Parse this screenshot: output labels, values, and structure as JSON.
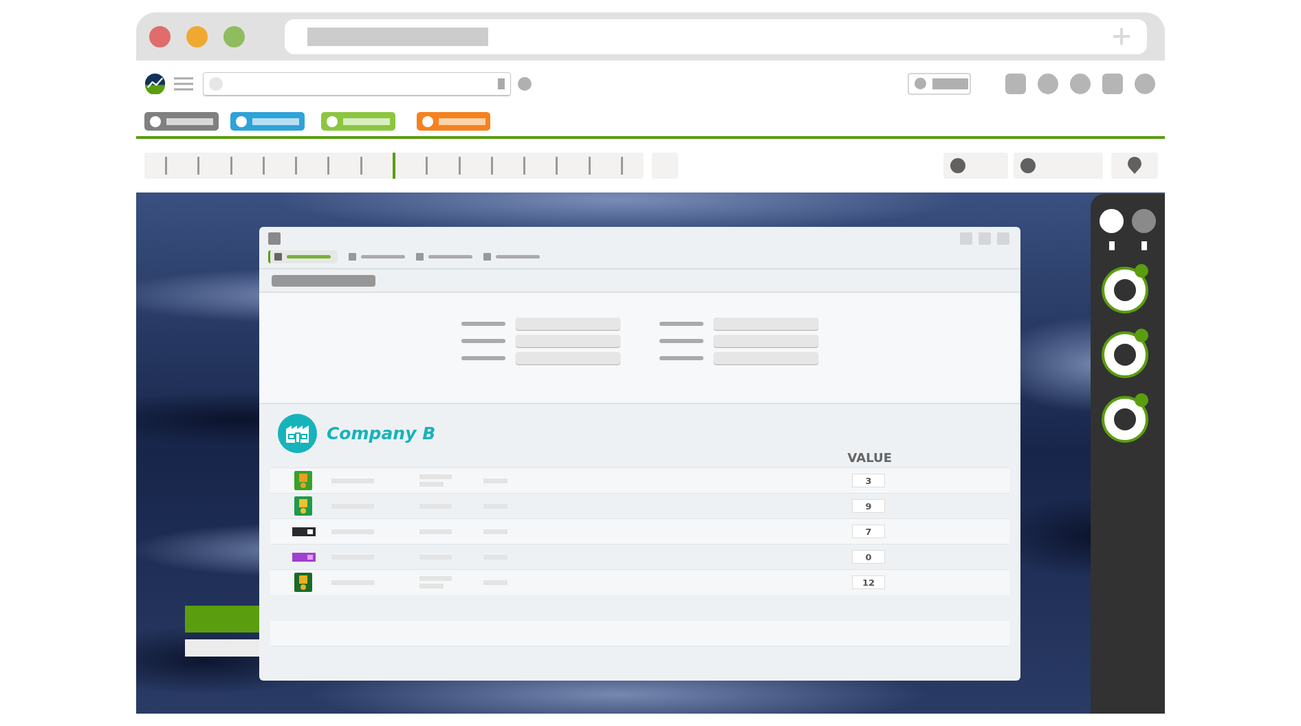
{
  "dialog": {
    "tabs": [
      {
        "selected": true
      },
      {
        "selected": false
      },
      {
        "selected": false
      },
      {
        "selected": false
      }
    ],
    "company": {
      "name": "Company B"
    },
    "table": {
      "columns": [
        "VALUE"
      ],
      "rows": [
        {
          "value": "3"
        },
        {
          "value": "9"
        },
        {
          "value": "7"
        },
        {
          "value": "0"
        },
        {
          "value": "12"
        }
      ]
    }
  }
}
